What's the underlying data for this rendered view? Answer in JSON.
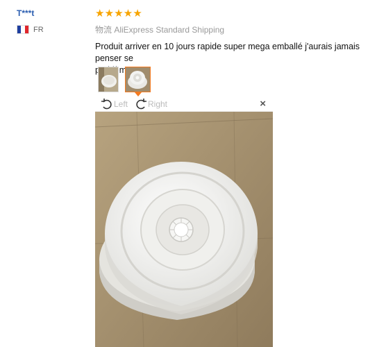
{
  "reviewer": {
    "name": "T***t",
    "country_code": "FR"
  },
  "review": {
    "rating": 5,
    "shipping": "物流 AliExpress Standard Shipping",
    "text": "Produit arriver en 10 jours rapide super mega emballé j'aurais jamais penser se\nproblème"
  },
  "viewer": {
    "rotate_left_label": "Left",
    "rotate_right_label": "Right",
    "close_label": "×"
  },
  "colors": {
    "star": "#f7a400",
    "accent": "#f47a20",
    "link": "#2a5db0"
  }
}
